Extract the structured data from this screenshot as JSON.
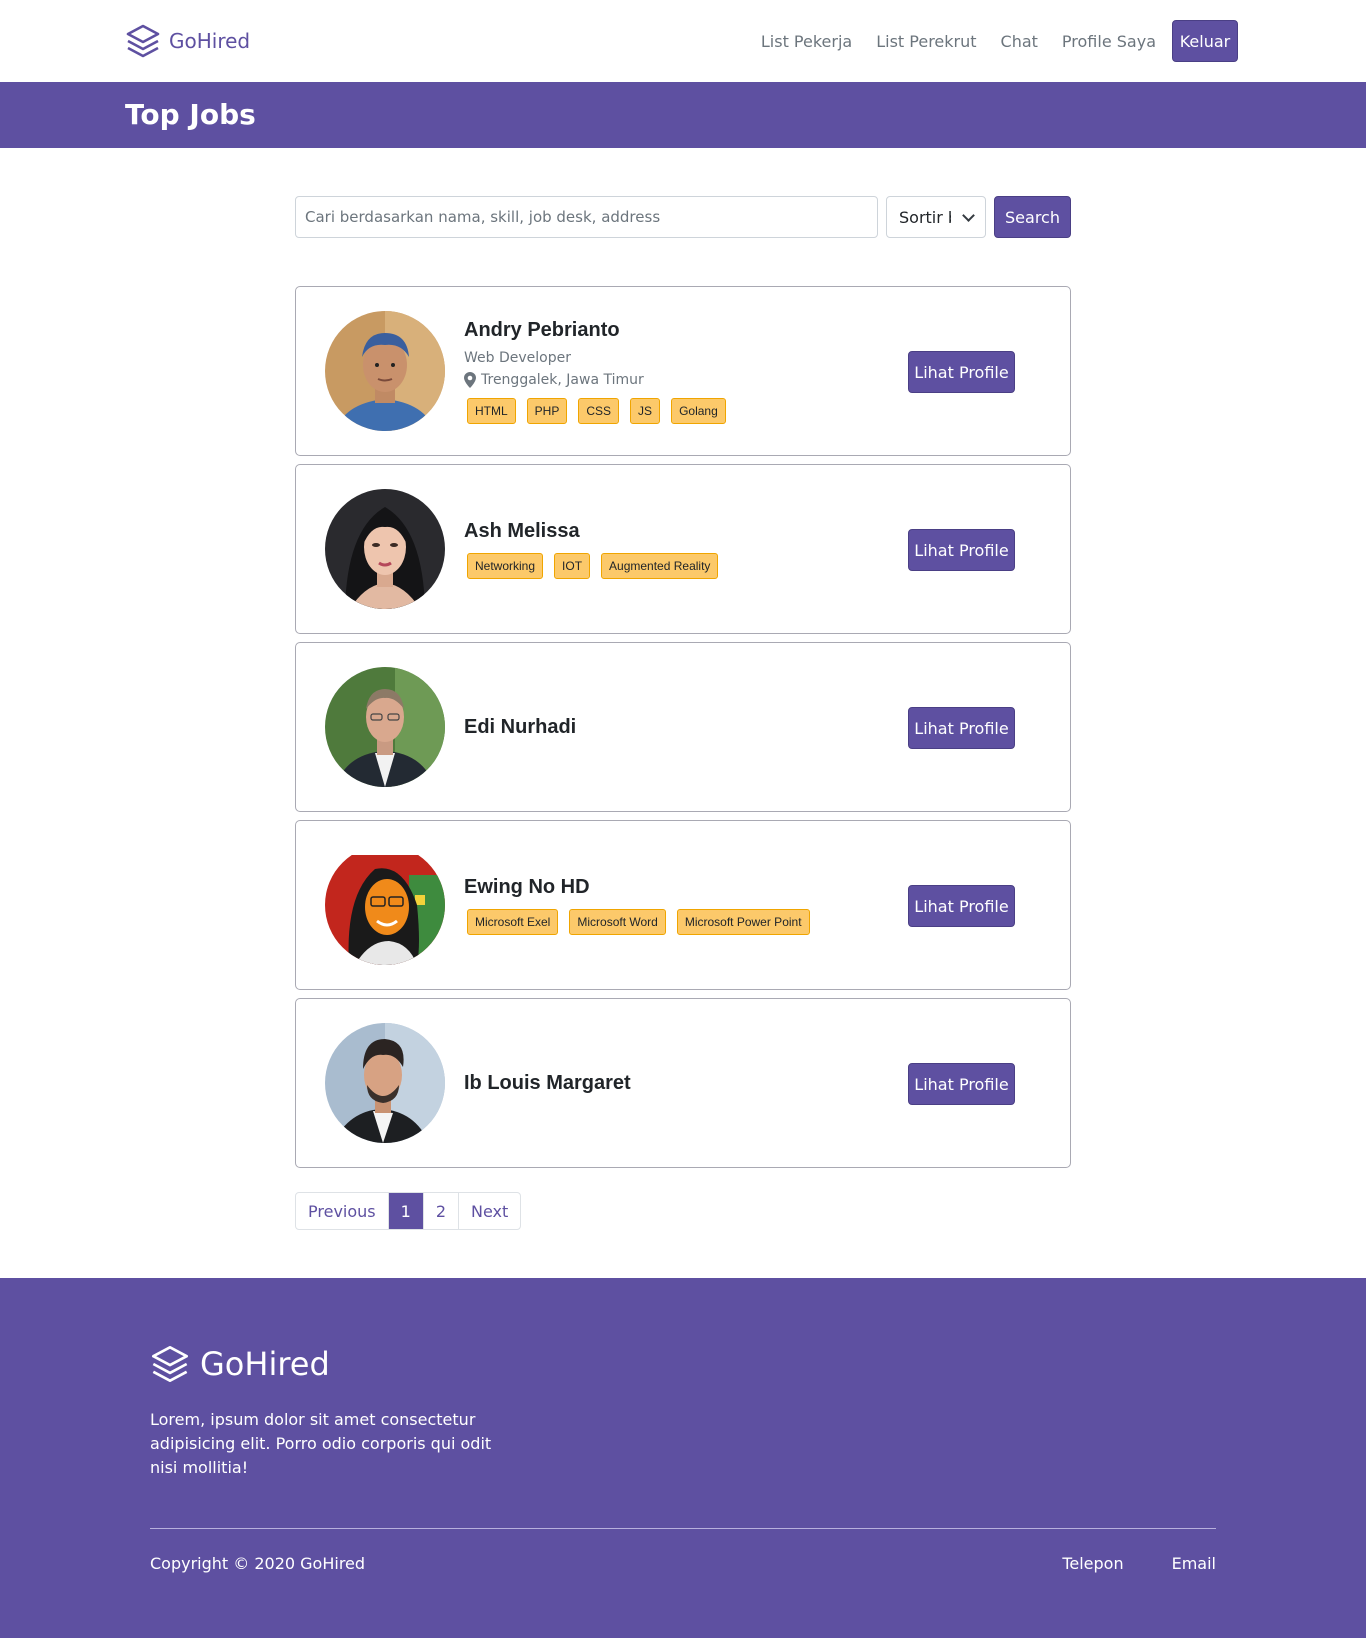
{
  "navbar": {
    "brand": "GoHired",
    "links": [
      "List Pekerja",
      "List Perekrut",
      "Chat",
      "Profile Saya"
    ],
    "logout_label": "Keluar"
  },
  "band": {
    "title": "Top Jobs"
  },
  "search": {
    "placeholder": "Cari berdasarkan nama, skill, job desk, address",
    "sort_label": "Sortir berdasarkan",
    "button_label": "Search"
  },
  "workers": [
    {
      "name": "Andry Pebrianto",
      "role": "Web Developer",
      "location": "Trenggalek, Jawa Timur",
      "skills": [
        "HTML",
        "PHP",
        "CSS",
        "JS",
        "Golang"
      ],
      "button": "Lihat Profile"
    },
    {
      "name": "Ash Melissa",
      "role": "",
      "location": "",
      "skills": [
        "Networking",
        "IOT",
        "Augmented Reality"
      ],
      "button": "Lihat Profile"
    },
    {
      "name": "Edi Nurhadi",
      "role": "",
      "location": "",
      "skills": [],
      "button": "Lihat Profile"
    },
    {
      "name": "Ewing No HD",
      "role": "",
      "location": "",
      "skills": [
        "Microsoft Exel",
        "Microsoft Word",
        "Microsoft Power Point"
      ],
      "button": "Lihat Profile"
    },
    {
      "name": "Ib Louis Margaret",
      "role": "",
      "location": "",
      "skills": [],
      "button": "Lihat Profile"
    }
  ],
  "pagination": {
    "previous": "Previous",
    "pages": [
      "1",
      "2"
    ],
    "active": "1",
    "next": "Next"
  },
  "footer": {
    "brand": "GoHired",
    "description": "Lorem, ipsum dolor sit amet consectetur adipisicing elit. Porro odio corporis qui odit nisi mollitia!",
    "copyright": "Copyright © 2020 GoHired",
    "links": [
      "Telepon",
      "Email"
    ]
  },
  "colors": {
    "primary": "#5e50a1",
    "skill_badge": "#fcc96a",
    "skill_border": "#f0a500"
  },
  "icons": {
    "brand": "layers-icon",
    "location": "map-pin-icon",
    "sort": "chevron-down-icon"
  }
}
